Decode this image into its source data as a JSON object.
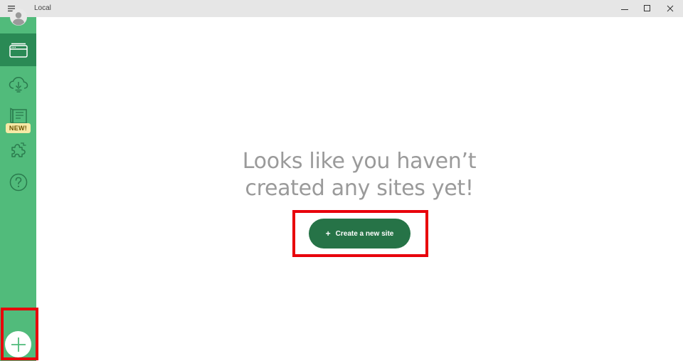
{
  "window": {
    "title": "Local",
    "controls": [
      "minimize",
      "maximize",
      "close"
    ]
  },
  "sidebar": {
    "items": [
      {
        "name": "account",
        "icon": "avatar-icon"
      },
      {
        "name": "local-sites",
        "icon": "browser-window-icon",
        "active": true
      },
      {
        "name": "connect",
        "icon": "cloud-icon"
      },
      {
        "name": "blueprints",
        "icon": "blueprint-icon"
      },
      {
        "name": "add-ons",
        "icon": "puzzle-icon"
      },
      {
        "name": "help",
        "icon": "question-icon"
      }
    ],
    "badge": "NEW!",
    "add_button_icon": "plus-icon"
  },
  "main": {
    "headline_line1": "Looks like you haven’t",
    "headline_line2": "created any sites yet!",
    "create_button_label": "Create a new site",
    "create_button_icon": "+"
  },
  "colors": {
    "sidebar": "#51bb7b",
    "sidebar_active": "#2a8a55",
    "button": "#267347",
    "highlight": "#e8000b",
    "badge": "#f7e9a6"
  }
}
